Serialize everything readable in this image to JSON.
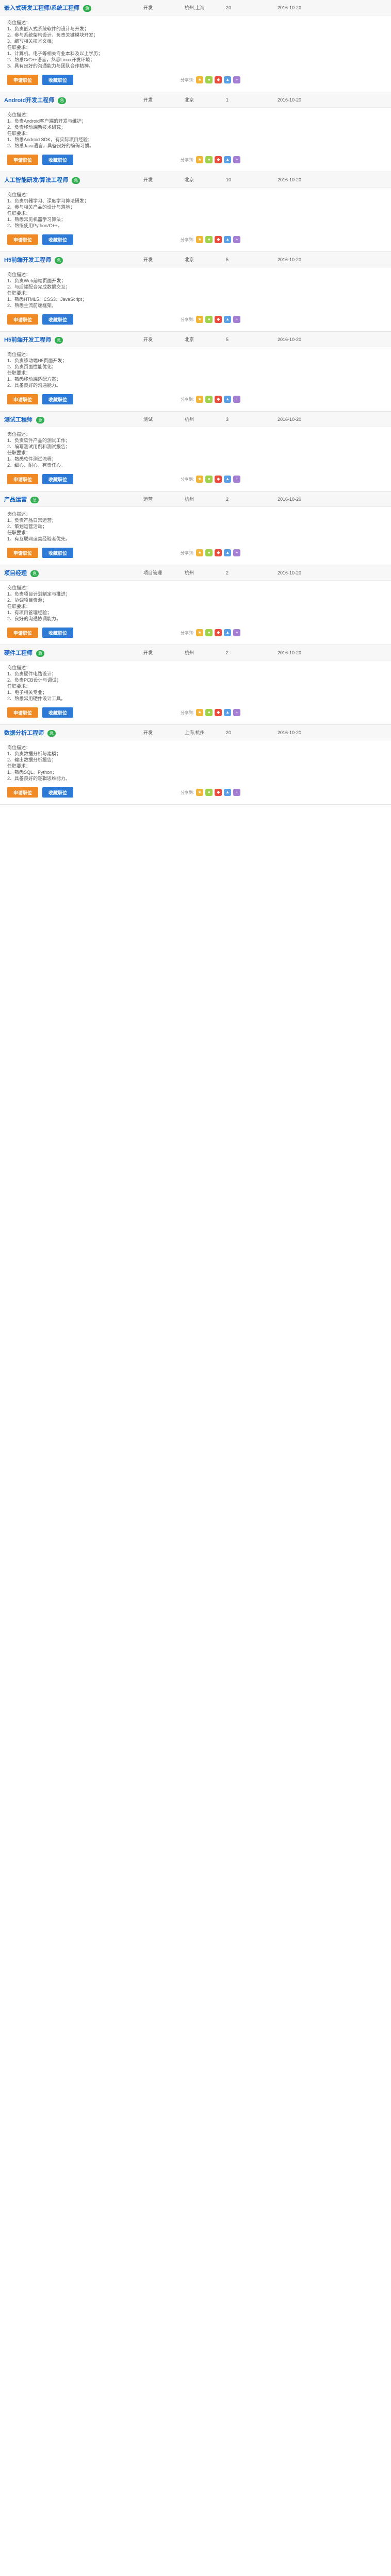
{
  "share_label": "分享到:",
  "buttons": {
    "apply": "申请职位",
    "favorite": "收藏职位"
  },
  "jobs": [
    {
      "title": "嵌入式研发工程师/系统工程师",
      "badge": "急",
      "company": "开发",
      "location": "杭州,上海",
      "count": "20",
      "date": "2016-10-20",
      "lines": [
        "岗位描述：",
        "1、负责嵌入式系统软件的设计与开发；",
        "2、参与系统架构设计，负责关键模块开发；",
        "3、编写相关技术文档；",
        "任职要求：",
        "1、计算机、电子等相关专业本科及以上学历；",
        "2、熟悉C/C++语言，熟悉Linux开发环境；",
        "3、具有良好的沟通能力与团队合作精神。"
      ]
    },
    {
      "title": "Android开发工程师",
      "badge": "急",
      "company": "开发",
      "location": "北京",
      "count": "1",
      "date": "2016-10-20",
      "lines": [
        "岗位描述：",
        "1、负责Android客户端的开发与维护；",
        "2、负责移动端新技术研究；",
        "任职要求：",
        "1、熟悉Android SDK，有实际项目经验；",
        "2、熟悉Java语言，具备良好的编码习惯。"
      ]
    },
    {
      "title": "人工智能研发/算法工程师",
      "badge": "急",
      "company": "开发",
      "location": "北京",
      "count": "10",
      "date": "2016-10-20",
      "lines": [
        "岗位描述：",
        "1、负责机器学习、深度学习算法研发；",
        "2、参与相关产品的设计与落地；",
        "任职要求：",
        "1、熟悉常见机器学习算法；",
        "2、熟练使用Python/C++。"
      ]
    },
    {
      "title": "H5前端开发工程师",
      "badge": "急",
      "company": "开发",
      "location": "北京",
      "count": "5",
      "date": "2016-10-20",
      "lines": [
        "岗位描述：",
        "1、负责Web前端页面开发；",
        "2、与后端配合完成数据交互；",
        "任职要求：",
        "1、熟悉HTML5、CSS3、JavaScript；",
        "2、熟悉主流前端框架。"
      ]
    },
    {
      "title": "H5前端开发工程师",
      "badge": "急",
      "company": "开发",
      "location": "北京",
      "count": "5",
      "date": "2016-10-20",
      "lines": [
        "岗位描述：",
        "1、负责移动端H5页面开发；",
        "2、负责页面性能优化；",
        "任职要求：",
        "1、熟悉移动端适配方案；",
        "2、具备良好的沟通能力。"
      ]
    },
    {
      "title": "测试工程师",
      "badge": "急",
      "company": "测试",
      "location": "杭州",
      "count": "3",
      "date": "2016-10-20",
      "lines": [
        "岗位描述：",
        "1、负责软件产品的测试工作；",
        "2、编写测试用例和测试报告；",
        "任职要求：",
        "1、熟悉软件测试流程；",
        "2、细心、耐心，有责任心。"
      ]
    },
    {
      "title": "产品运营",
      "badge": "急",
      "company": "运营",
      "location": "杭州",
      "count": "2",
      "date": "2016-10-20",
      "lines": [
        "岗位描述：",
        "1、负责产品日常运营；",
        "2、策划运营活动；",
        "任职要求：",
        "1、有互联网运营经验者优先。"
      ]
    },
    {
      "title": "项目经理",
      "badge": "急",
      "company": "项目管理",
      "location": "杭州",
      "count": "2",
      "date": "2016-10-20",
      "lines": [
        "岗位描述：",
        "1、负责项目计划制定与推进；",
        "2、协调项目资源；",
        "任职要求：",
        "1、有项目管理经验；",
        "2、良好的沟通协调能力。"
      ]
    },
    {
      "title": "硬件工程师",
      "badge": "急",
      "company": "开发",
      "location": "杭州",
      "count": "2",
      "date": "2016-10-20",
      "lines": [
        "岗位描述：",
        "1、负责硬件电路设计；",
        "2、负责PCB设计与调试；",
        "任职要求：",
        "1、电子相关专业；",
        "2、熟悉常用硬件设计工具。"
      ]
    },
    {
      "title": "数据分析工程师",
      "badge": "急",
      "company": "开发",
      "location": "上海,杭州",
      "count": "20",
      "date": "2016-10-20",
      "lines": [
        "岗位描述：",
        "1、负责数据分析与建模；",
        "2、输出数据分析报告；",
        "任职要求：",
        "1、熟悉SQL、Python；",
        "2、具备良好的逻辑思维能力。"
      ]
    }
  ]
}
